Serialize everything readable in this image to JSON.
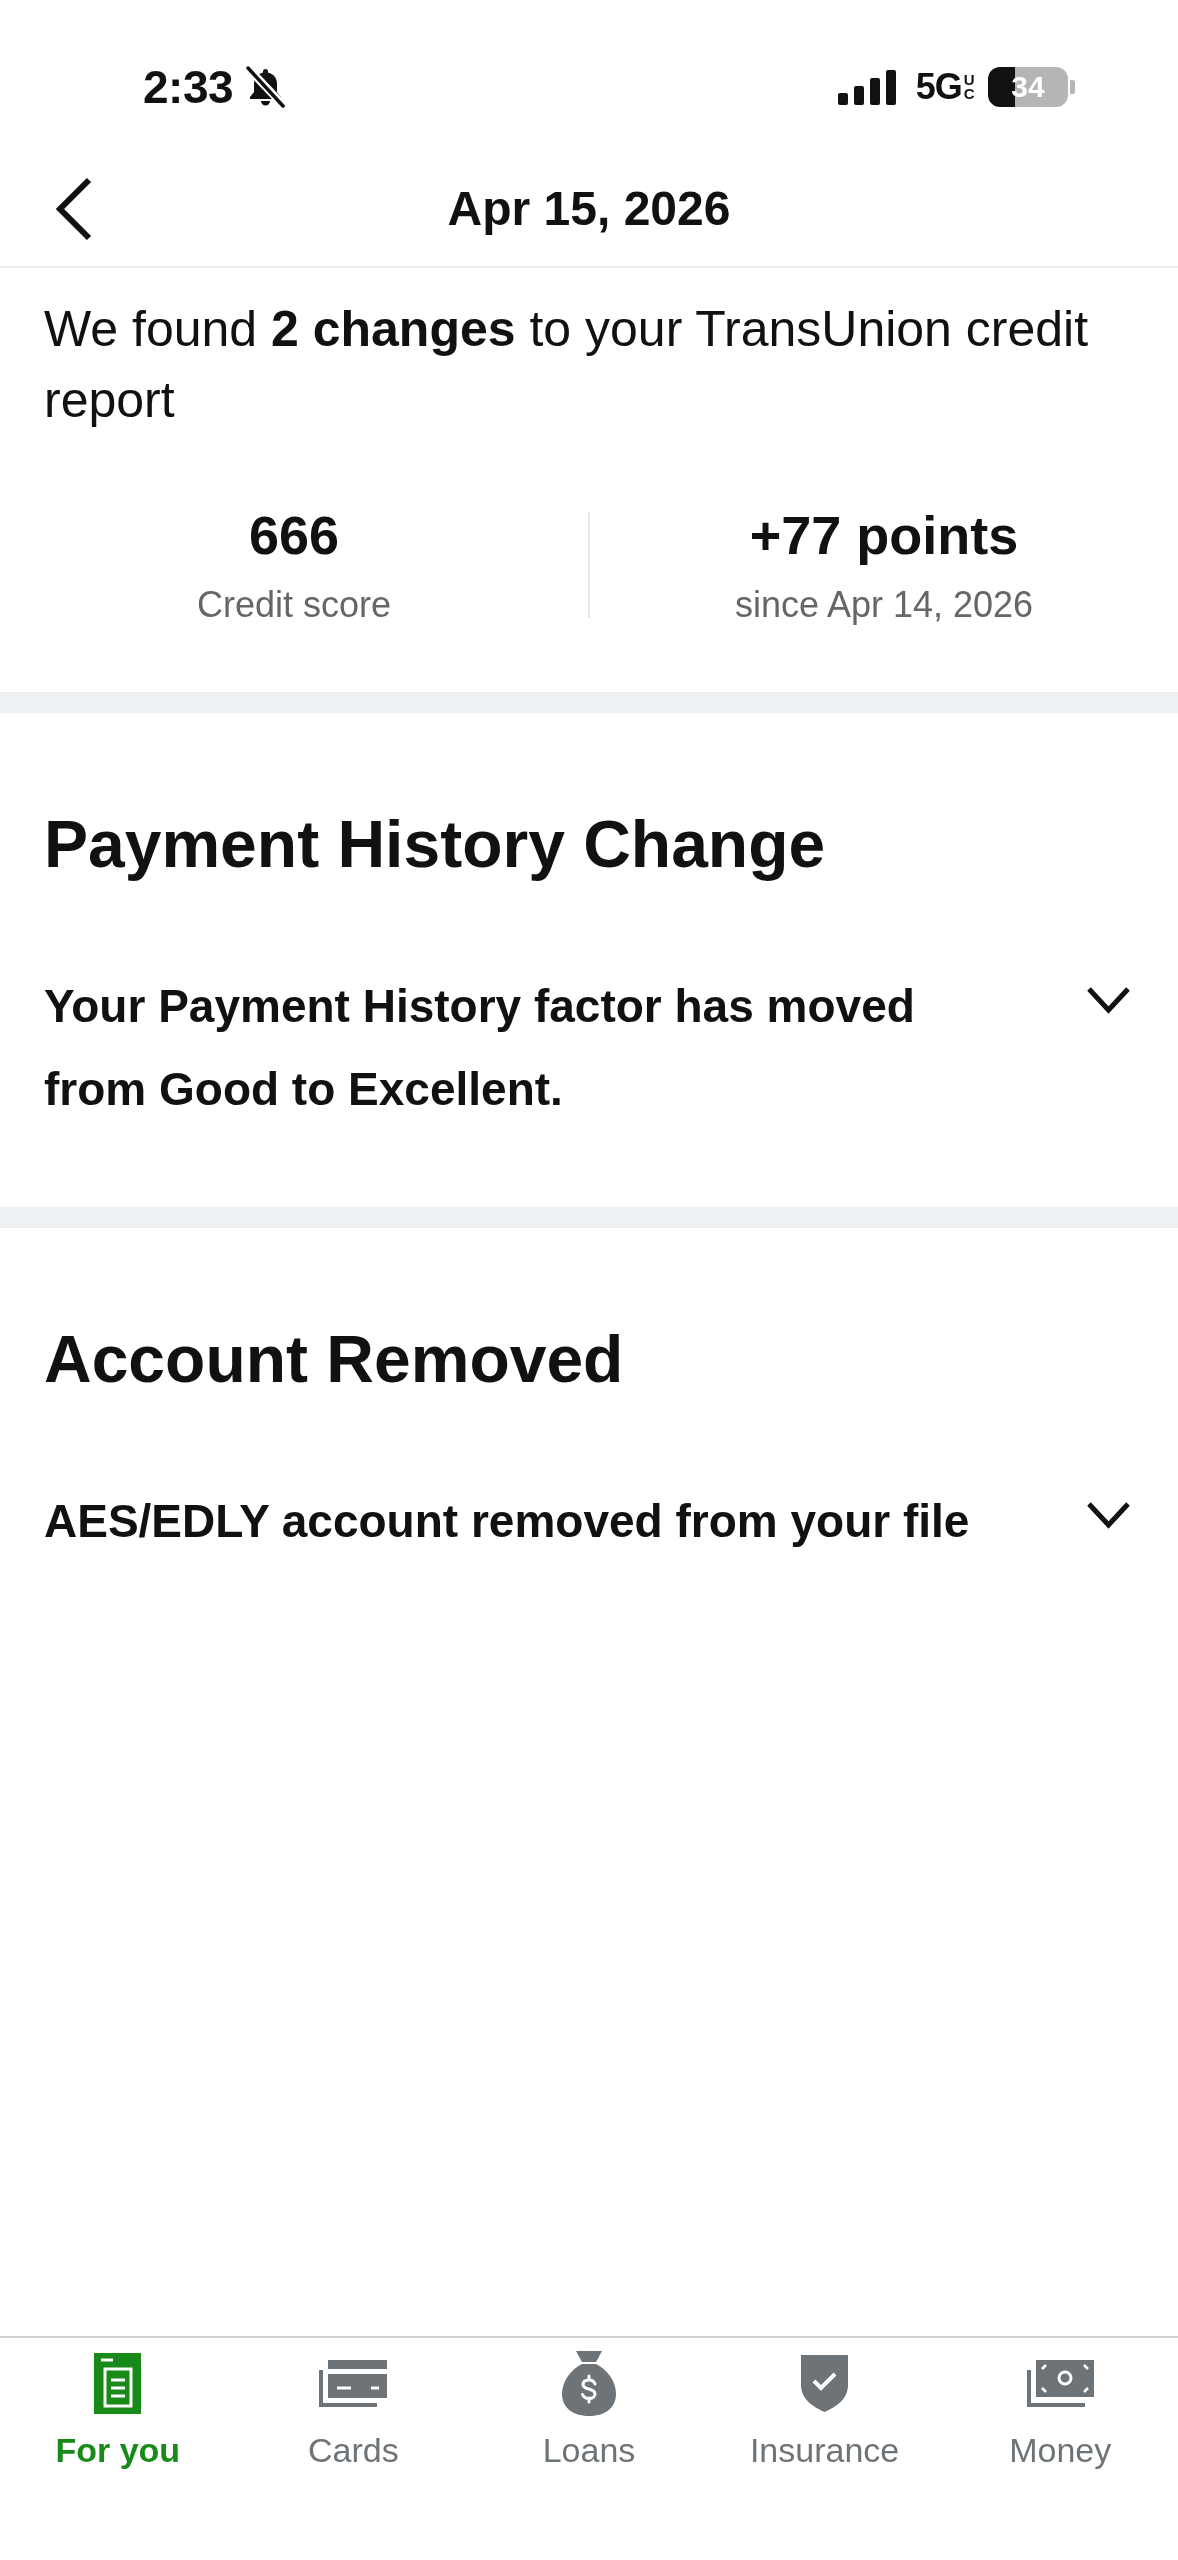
{
  "status_bar": {
    "time": "2:33",
    "network": "5G",
    "network_badge": "UC",
    "battery": "34"
  },
  "header": {
    "title": "Apr 15, 2026"
  },
  "intro": "We found **2 changes** to your TransUnion credit report",
  "stats": [
    {
      "value": "666",
      "label": "Credit score"
    },
    {
      "value": "+77 points",
      "label": "since Apr 14, 2026"
    }
  ],
  "sections": [
    {
      "title": "Payment History Change",
      "summary": "Your Payment History factor has moved from Good to Excellent.",
      "expanded": false
    },
    {
      "title": "Account Removed",
      "summary": "AES/EDLY account removed from your file",
      "expanded": false
    }
  ],
  "bottom_nav": [
    {
      "label": "For you",
      "selected": true
    },
    {
      "label": "Cards",
      "selected": false
    },
    {
      "label": "Loans",
      "selected": false
    },
    {
      "label": "Insurance",
      "selected": false
    },
    {
      "label": "Money",
      "selected": false
    }
  ]
}
